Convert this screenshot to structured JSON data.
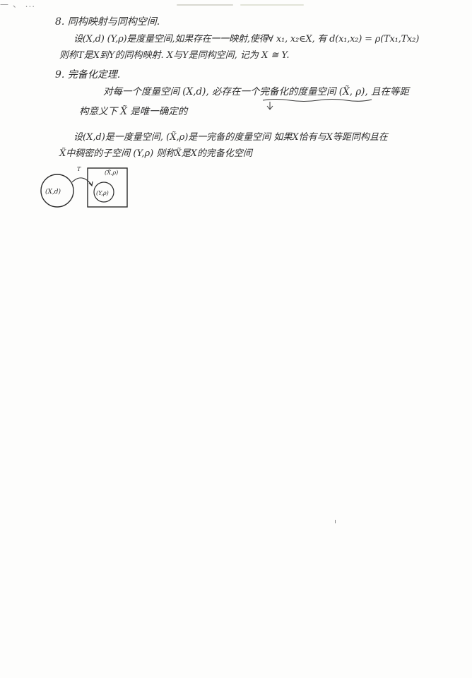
{
  "page": {
    "top_cut_text": "— 、 ..."
  },
  "section8": {
    "heading": "8. 同构映射与同构空间.",
    "line1": "设(X,d) (Y,ρ)是度量空间,如果存在一一映射,使得∀ x₁, x₂∈X, 有 d(x₁,x₂) = ρ(Tx₁,Tx₂)",
    "line2": "则称T是X到Y的同构映射. X与Y是同构空间, 记为 X ≅ Y."
  },
  "section9": {
    "heading": "9. 完备化定理.",
    "line1": "对每一个度量空间 (X,d), 必存在一个完备化的度量空间 (X̃, ρ), 且在等距",
    "line2": "构意义下 X̃ 是唯一确定的",
    "def_line1": "设(X,d)是一度量空间, (X̃,ρ)是一完备的度量空间 如果X恰有与X等距同构且在",
    "def_line2": "X̃中稠密的子空间 (Y,ρ) 则称X̃是X的完备化空间"
  },
  "diagram": {
    "left_circle_label": "(X,d)",
    "arrow_label": "T",
    "box_label": "(X̃,ρ)",
    "inner_circle_label": "(Y,ρ)"
  }
}
